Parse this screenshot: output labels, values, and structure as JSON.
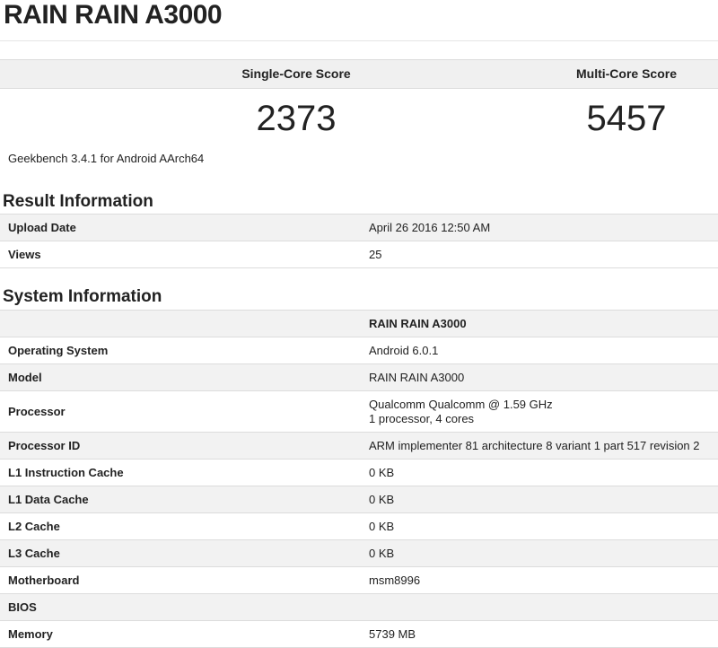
{
  "page": {
    "title": "RAIN RAIN A3000"
  },
  "scores": {
    "single_label": "Single-Core Score",
    "single_value": "2373",
    "multi_label": "Multi-Core Score",
    "multi_value": "5457"
  },
  "version": "Geekbench 3.4.1 for Android AArch64",
  "result_info": {
    "title": "Result Information",
    "rows": [
      {
        "label": "Upload Date",
        "value": "April 26 2016 12:50 AM"
      },
      {
        "label": "Views",
        "value": "25"
      }
    ]
  },
  "system_info": {
    "title": "System Information",
    "header_value": "RAIN RAIN A3000",
    "rows": [
      {
        "label": "Operating System",
        "value": "Android 6.0.1"
      },
      {
        "label": "Model",
        "value": "RAIN RAIN A3000"
      },
      {
        "label": "Processor",
        "value": "Qualcomm Qualcomm @ 1.59 GHz",
        "value2": "1 processor, 4 cores"
      },
      {
        "label": "Processor ID",
        "value": "ARM implementer 81 architecture 8 variant 1 part 517 revision 2"
      },
      {
        "label": "L1 Instruction Cache",
        "value": "0 KB"
      },
      {
        "label": "L1 Data Cache",
        "value": "0 KB"
      },
      {
        "label": "L2 Cache",
        "value": "0 KB"
      },
      {
        "label": "L3 Cache",
        "value": "0 KB"
      },
      {
        "label": "Motherboard",
        "value": "msm8996"
      },
      {
        "label": "BIOS",
        "value": ""
      },
      {
        "label": "Memory",
        "value": "5739 MB"
      }
    ]
  }
}
